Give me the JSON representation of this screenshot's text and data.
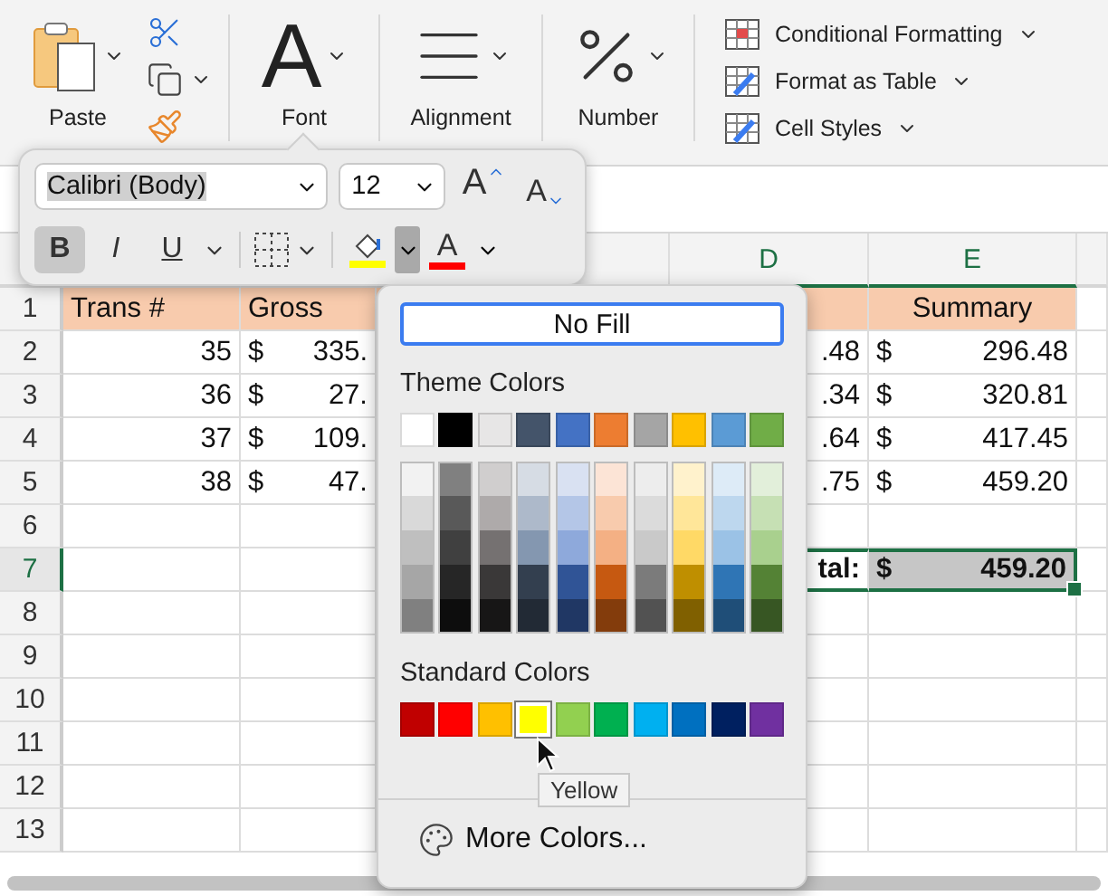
{
  "ribbon": {
    "paste": {
      "label": "Paste"
    },
    "groups": [
      {
        "kind": "font",
        "glyph": "A",
        "label": "Font"
      },
      {
        "kind": "alignment",
        "label": "Alignment"
      },
      {
        "kind": "number",
        "label": "Number"
      }
    ],
    "styles": [
      {
        "kind": "conditional",
        "label": "Conditional Formatting"
      },
      {
        "kind": "table",
        "label": "Format as Table"
      },
      {
        "kind": "cell",
        "label": "Cell Styles"
      }
    ]
  },
  "mini_toolbar": {
    "font": "Calibri (Body)",
    "size": "12",
    "size_buttons": [
      {
        "kind": "grow",
        "label": "A"
      },
      {
        "kind": "shrink",
        "label": "A"
      }
    ],
    "style_buttons": [
      {
        "kind": "bold",
        "label": "B",
        "selected": true
      },
      {
        "kind": "italic",
        "label": "I",
        "selected": false
      },
      {
        "kind": "underline",
        "label": "U",
        "selected": false
      }
    ],
    "fill_color": {
      "color": "#ffff00",
      "expanded": true
    },
    "font_color": {
      "label": "A",
      "color": "#ff0000",
      "expanded": false
    }
  },
  "columns": [
    {
      "label": "D",
      "selected": true
    },
    {
      "label": "E",
      "selected": true
    }
  ],
  "rows": [
    {
      "number": "1",
      "kind": "header",
      "selected": false,
      "a": "Trans #",
      "b": "Gross",
      "e": "Summary"
    },
    {
      "number": "2",
      "kind": "data",
      "selected": false,
      "a": "35",
      "b_symbol": "$",
      "b": "335.",
      "d": ".48",
      "e_symbol": "$",
      "e": "296.48"
    },
    {
      "number": "3",
      "kind": "data",
      "selected": false,
      "a": "36",
      "b_symbol": "$",
      "b": "27.",
      "d": ".34",
      "e_symbol": "$",
      "e": "320.81"
    },
    {
      "number": "4",
      "kind": "data",
      "selected": false,
      "a": "37",
      "b_symbol": "$",
      "b": "109.",
      "d": ".64",
      "e_symbol": "$",
      "e": "417.45"
    },
    {
      "number": "5",
      "kind": "data",
      "selected": false,
      "a": "38",
      "b_symbol": "$",
      "b": "47.",
      "d": ".75",
      "e_symbol": "$",
      "e": "459.20"
    },
    {
      "number": "6",
      "kind": "data",
      "selected": false
    },
    {
      "number": "7",
      "kind": "total",
      "selected": true,
      "d": "tal:",
      "e_symbol": "$",
      "e": "459.20"
    },
    {
      "number": "8",
      "kind": "data",
      "selected": false
    },
    {
      "number": "9",
      "kind": "data",
      "selected": false
    },
    {
      "number": "10",
      "kind": "data",
      "selected": false
    },
    {
      "number": "11",
      "kind": "data",
      "selected": false
    },
    {
      "number": "12",
      "kind": "data",
      "selected": false
    },
    {
      "number": "13",
      "kind": "data",
      "selected": false
    }
  ],
  "fill_menu": {
    "no_fill": "No Fill",
    "theme_label": "Theme Colors",
    "theme": [
      {
        "color": "#ffffff",
        "shades": [
          {
            "color": "#f2f2f2"
          },
          {
            "color": "#d9d9d9"
          },
          {
            "color": "#bfbfbf"
          },
          {
            "color": "#a6a6a6"
          },
          {
            "color": "#808080"
          }
        ]
      },
      {
        "color": "#000000",
        "shades": [
          {
            "color": "#808080"
          },
          {
            "color": "#595959"
          },
          {
            "color": "#404040"
          },
          {
            "color": "#262626"
          },
          {
            "color": "#0d0d0d"
          }
        ]
      },
      {
        "color": "#e7e6e6",
        "shades": [
          {
            "color": "#d0cece"
          },
          {
            "color": "#aeaaaa"
          },
          {
            "color": "#757171"
          },
          {
            "color": "#3a3838"
          },
          {
            "color": "#171616"
          }
        ]
      },
      {
        "color": "#44546a",
        "shades": [
          {
            "color": "#d6dce4"
          },
          {
            "color": "#adb9ca"
          },
          {
            "color": "#8497b0"
          },
          {
            "color": "#333f4f"
          },
          {
            "color": "#222a35"
          }
        ]
      },
      {
        "color": "#4472c4",
        "shades": [
          {
            "color": "#d9e1f2"
          },
          {
            "color": "#b4c6e7"
          },
          {
            "color": "#8ea9db"
          },
          {
            "color": "#305496"
          },
          {
            "color": "#203764"
          }
        ]
      },
      {
        "color": "#ed7d31",
        "shades": [
          {
            "color": "#fce4d6"
          },
          {
            "color": "#f8cbad"
          },
          {
            "color": "#f4b084"
          },
          {
            "color": "#c65911"
          },
          {
            "color": "#833c0c"
          }
        ]
      },
      {
        "color": "#a5a5a5",
        "shades": [
          {
            "color": "#ededed"
          },
          {
            "color": "#dbdbdb"
          },
          {
            "color": "#c9c9c9"
          },
          {
            "color": "#7b7b7b"
          },
          {
            "color": "#525252"
          }
        ]
      },
      {
        "color": "#ffc000",
        "shades": [
          {
            "color": "#fff2cc"
          },
          {
            "color": "#ffe699"
          },
          {
            "color": "#ffd966"
          },
          {
            "color": "#bf8f00"
          },
          {
            "color": "#806000"
          }
        ]
      },
      {
        "color": "#5b9bd5",
        "shades": [
          {
            "color": "#ddebf7"
          },
          {
            "color": "#bdd7ee"
          },
          {
            "color": "#9bc2e6"
          },
          {
            "color": "#2f75b5"
          },
          {
            "color": "#1f4e78"
          }
        ]
      },
      {
        "color": "#70ad47",
        "shades": [
          {
            "color": "#e2efda"
          },
          {
            "color": "#c6e0b4"
          },
          {
            "color": "#a9d08e"
          },
          {
            "color": "#548235"
          },
          {
            "color": "#375623"
          }
        ]
      }
    ],
    "standard_label": "Standard Colors",
    "standard": [
      {
        "color": "#c00000",
        "selected": false
      },
      {
        "color": "#ff0000",
        "selected": false
      },
      {
        "color": "#ffc000",
        "selected": false
      },
      {
        "color": "#ffff00",
        "selected": true
      },
      {
        "color": "#92d050",
        "selected": false
      },
      {
        "color": "#00b050",
        "selected": false
      },
      {
        "color": "#00b0f0",
        "selected": false
      },
      {
        "color": "#0070c0",
        "selected": false
      },
      {
        "color": "#002060",
        "selected": false
      },
      {
        "color": "#7030a0",
        "selected": false
      }
    ],
    "tooltip": "Yellow",
    "more": "More Colors..."
  }
}
